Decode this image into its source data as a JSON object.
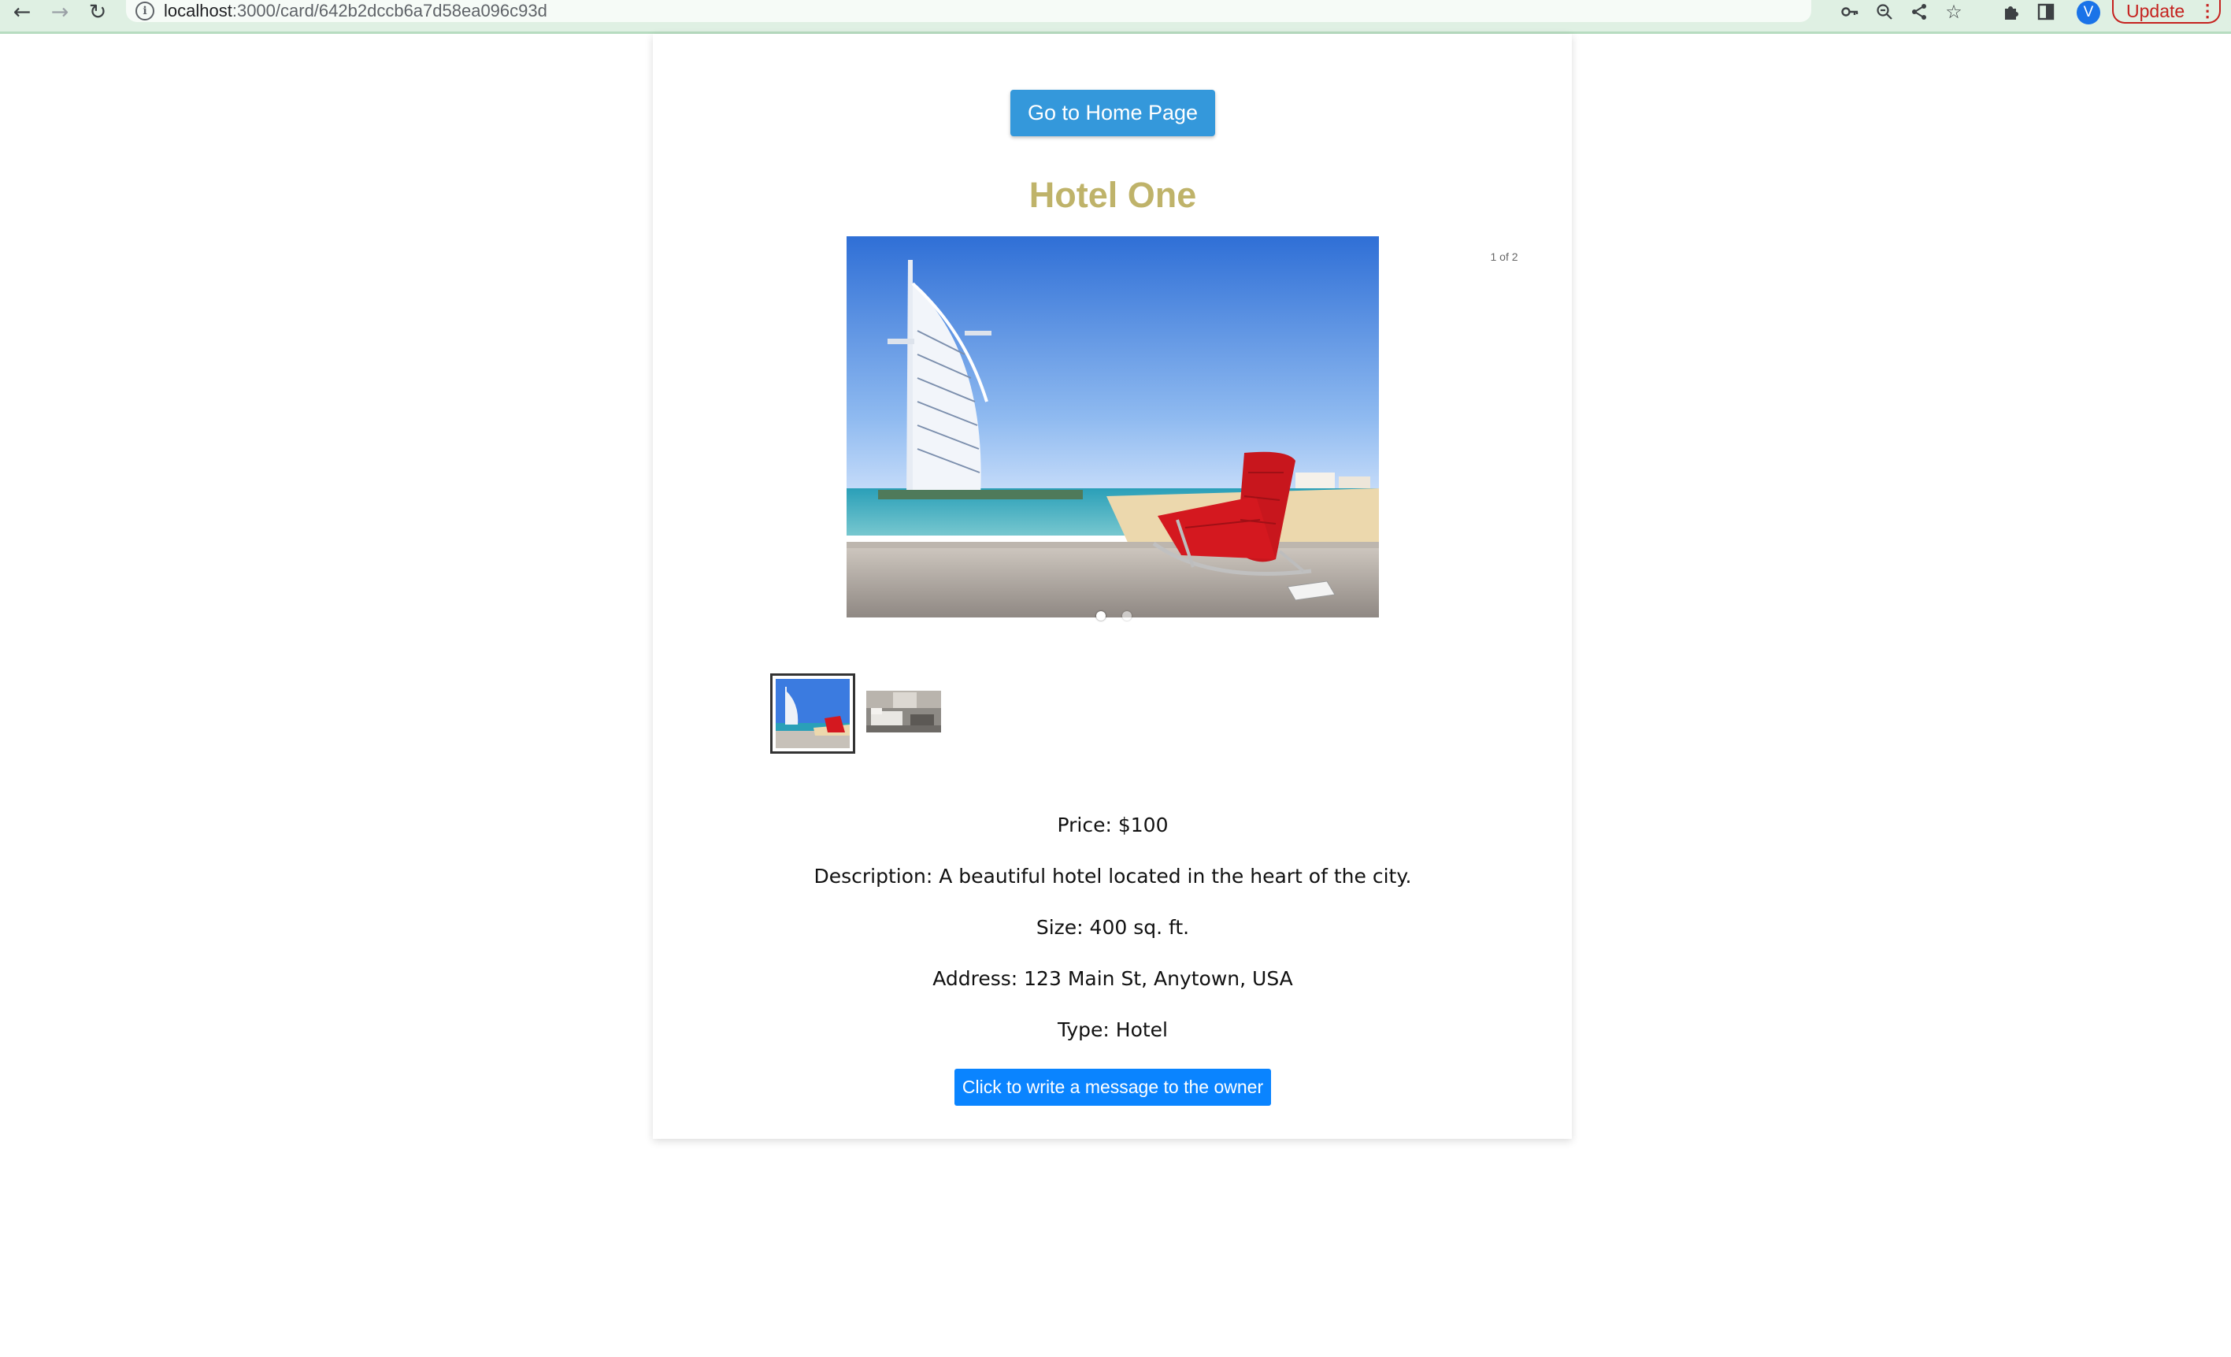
{
  "browser": {
    "url_host": "localhost",
    "url_path": ":3000/card/642b2dccb6a7d58ea096c93d",
    "profile_initial": "V",
    "update_label": "Update"
  },
  "page": {
    "home_button_label": "Go to Home Page",
    "title": "Hotel One",
    "carousel": {
      "counter": "1 of 2",
      "current_slide": 1,
      "slide_count": 2,
      "slides": [
        "beach-hotel-photo",
        "hotel-room-photo"
      ]
    },
    "details": {
      "price": "Price: $100",
      "description": "Description: A beautiful hotel located in the heart of the city.",
      "size": "Size: 400 sq. ft.",
      "address": "Address: 123 Main St, Anytown, USA",
      "type": "Type: Hotel"
    },
    "message_button_label": "Click to write a message to the owner"
  },
  "colors": {
    "title": "#bfb36a",
    "home_button": "#3498db",
    "message_button": "#0a84ff",
    "chrome_bar": "#dff0e3",
    "update_accent": "#c5221f"
  }
}
